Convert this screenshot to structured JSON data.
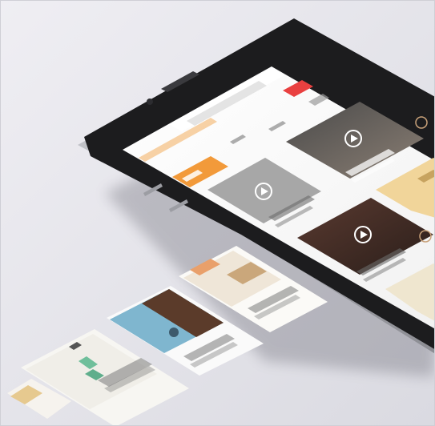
{
  "scene": {
    "description_labels": []
  },
  "app_screen": {
    "status_time": "",
    "url": "",
    "header_button": "",
    "sort_button": "",
    "tabs": [],
    "video_tiles": 4
  },
  "cards": [
    {
      "caption": ""
    },
    {
      "caption": ""
    },
    {
      "caption": ""
    },
    {
      "caption": ""
    }
  ],
  "colors": {
    "background": "#e4e4ea",
    "phone_body": "#1c1c1e",
    "phone_frame": "#b9bac0",
    "accent_red": "#e94040",
    "accent_orange": "#f29a3a",
    "card_blue": "#7fb6cf",
    "card_brown": "#5b3b2a"
  },
  "icons": [
    "play-icon",
    "play-icon",
    "play-icon",
    "play-icon"
  ]
}
